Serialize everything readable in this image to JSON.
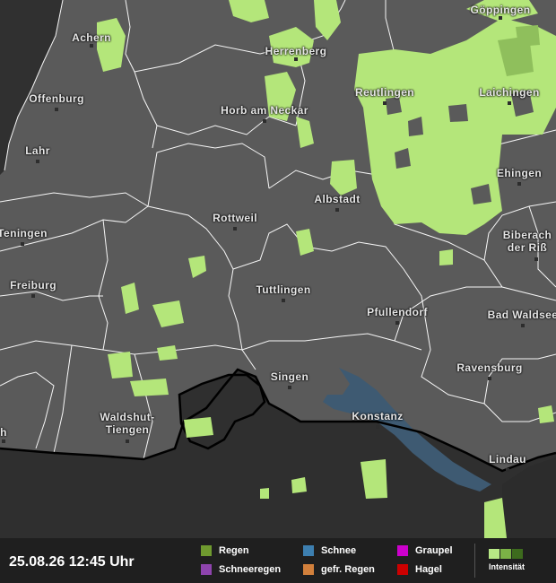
{
  "timestamp": "25.08.26 12:45 Uhr",
  "cities": [
    {
      "name": "Göppingen"
    },
    {
      "name": "Achern"
    },
    {
      "name": "Herrenberg"
    },
    {
      "name": "Offenburg"
    },
    {
      "name": "Reutlingen"
    },
    {
      "name": "Laichingen"
    },
    {
      "name": "Horb am Neckar"
    },
    {
      "name": "Lahr"
    },
    {
      "name": "Ehingen"
    },
    {
      "name": "Albstadt"
    },
    {
      "name": "Rottweil"
    },
    {
      "name": "Teningen"
    },
    {
      "name": "Biberach\nder Riß"
    },
    {
      "name": "Freiburg"
    },
    {
      "name": "Tuttlingen"
    },
    {
      "name": "Pfullendorf"
    },
    {
      "name": "Bad Waldsee"
    },
    {
      "name": "Ravensburg"
    },
    {
      "name": "Singen"
    },
    {
      "name": "Waldshut-\nTiengen"
    },
    {
      "name": "Konstanz"
    },
    {
      "name": "Lindau"
    },
    {
      "name": "h"
    }
  ],
  "legend": [
    {
      "label": "Regen",
      "color": "#6f9a2f"
    },
    {
      "label": "Schneeregen",
      "color": "#8e44ad"
    },
    {
      "label": "Schnee",
      "color": "#3d7fb0"
    },
    {
      "label": "gefr. Regen",
      "color": "#d2803c"
    },
    {
      "label": "Graupel",
      "color": "#cc00cc"
    },
    {
      "label": "Hagel",
      "color": "#cc0000"
    }
  ],
  "intensity": {
    "label": "Intensität",
    "colors": [
      "#b8e986",
      "#7bb246",
      "#3d6b1d"
    ]
  },
  "colors": {
    "land": "#5a5a5a",
    "foreign": "#2e2e2e",
    "lake": "#3e5a72",
    "rain": "#b4e67a",
    "borders": "#ffffff"
  }
}
